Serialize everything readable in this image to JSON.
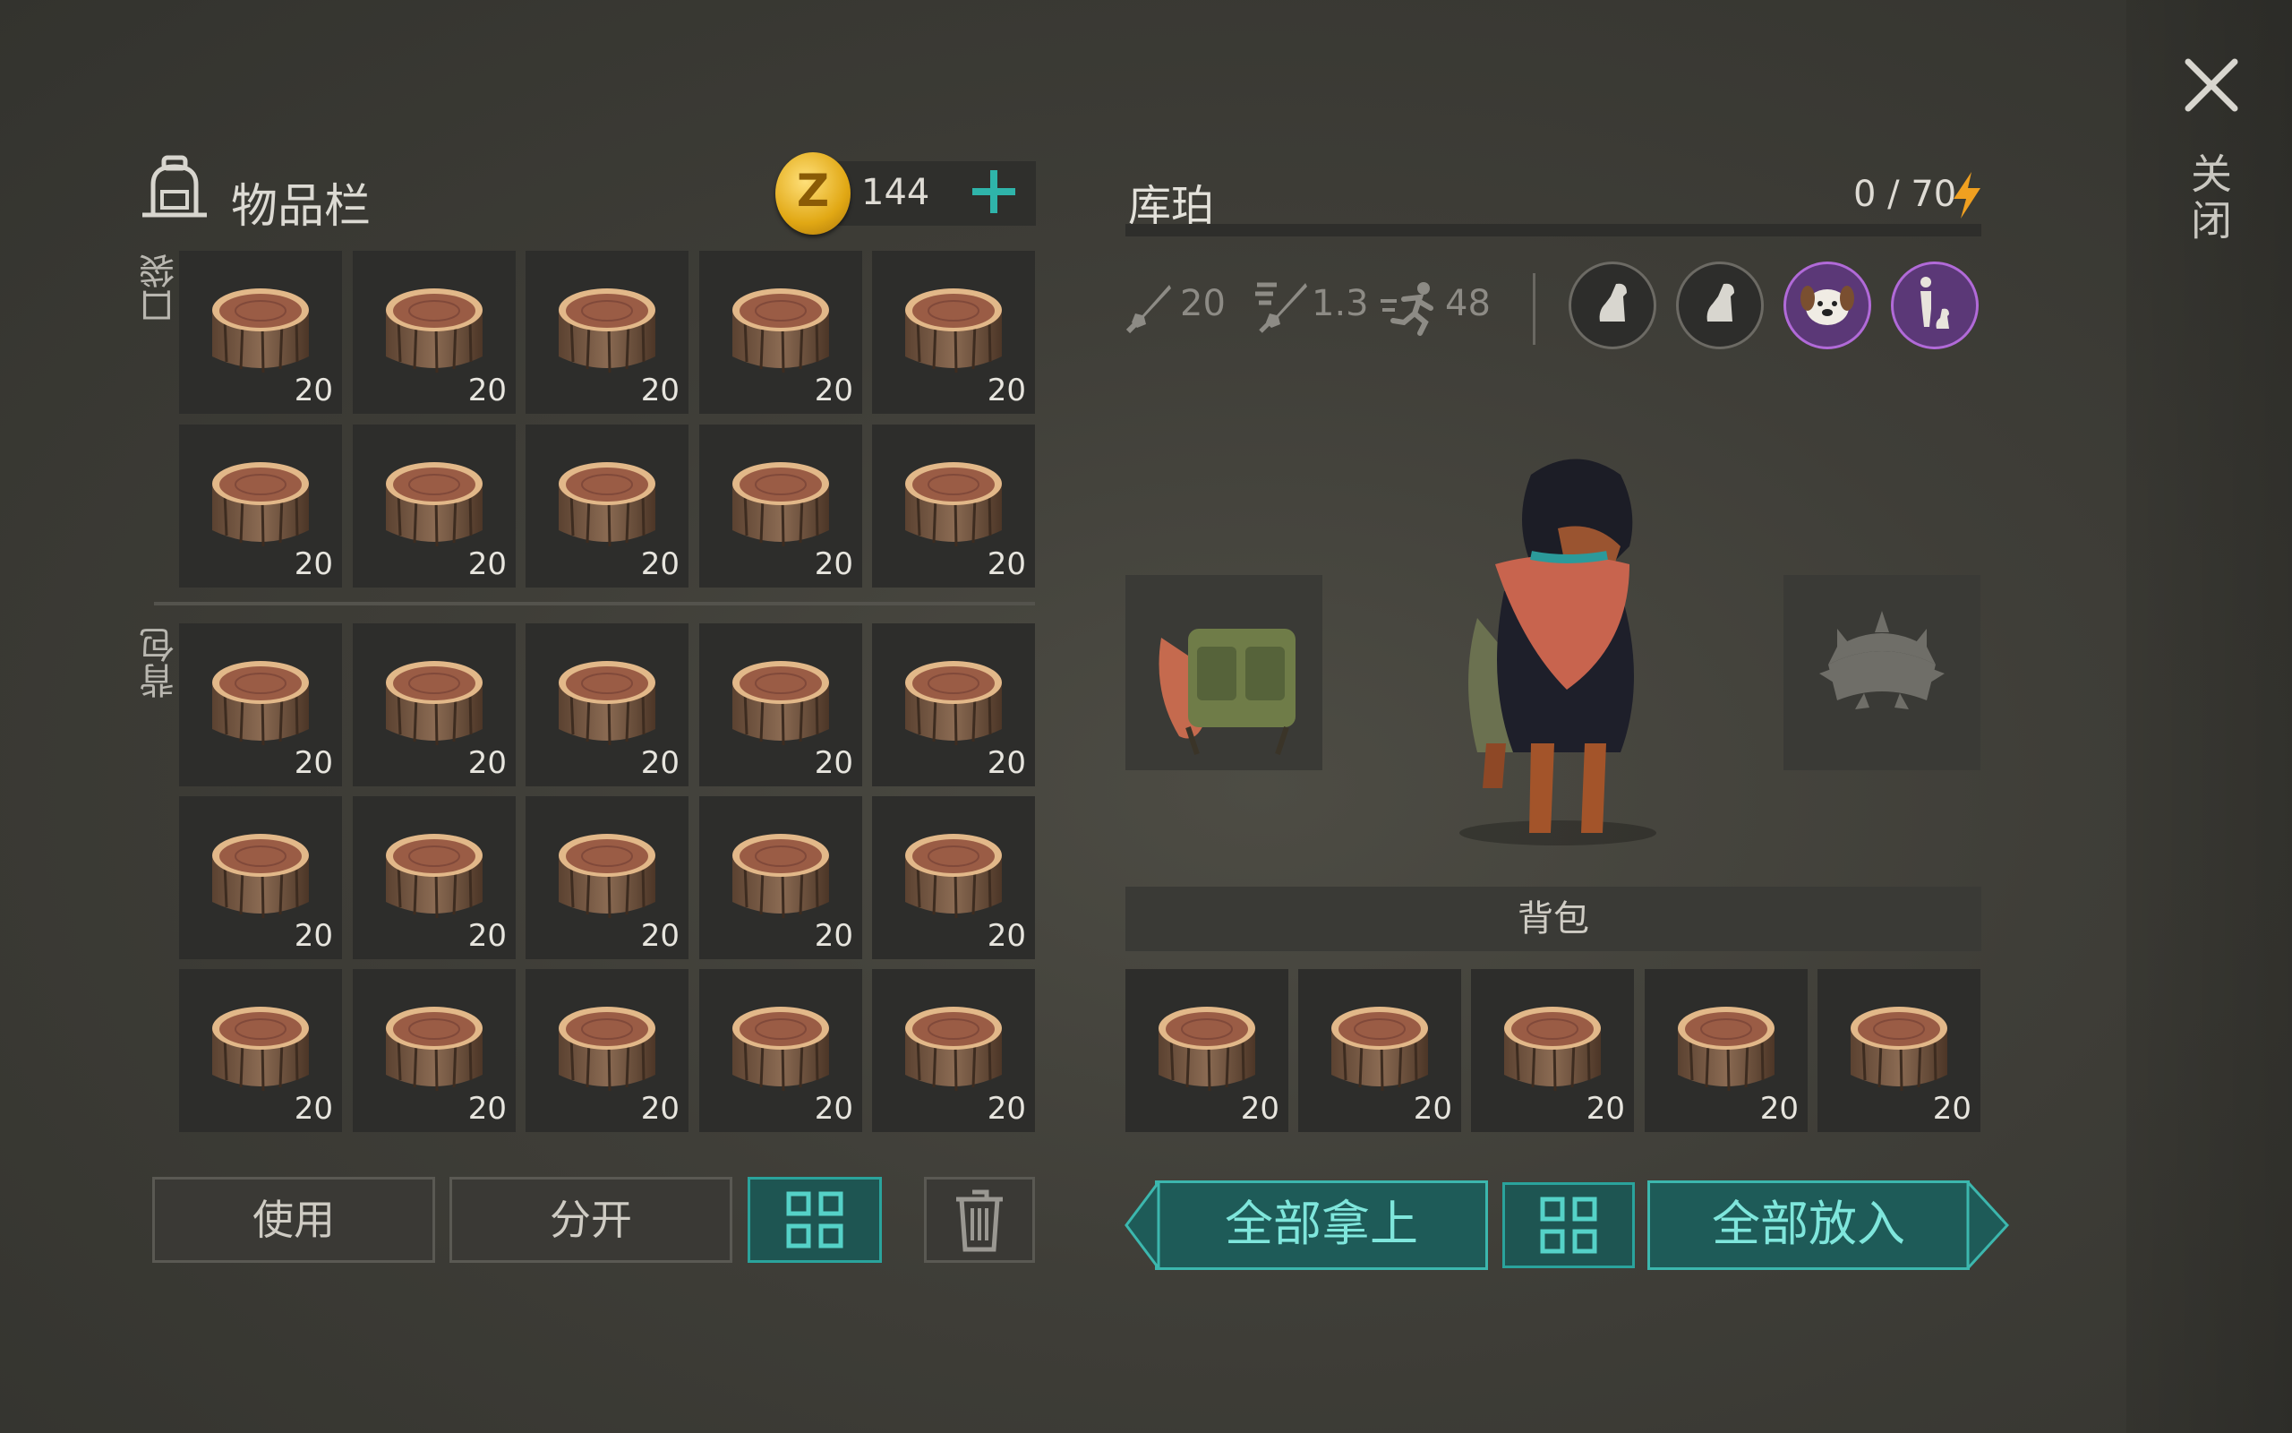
{
  "inventory": {
    "title": "物品栏",
    "coins": "144",
    "pocket_label": "口袋",
    "backpack_label": "背包",
    "item_icon": "log-icon",
    "slot_counts": [
      "20",
      "20",
      "20",
      "20",
      "20",
      "20",
      "20",
      "20",
      "20",
      "20",
      "20",
      "20",
      "20",
      "20",
      "20",
      "20",
      "20",
      "20",
      "20",
      "20",
      "20",
      "20",
      "20",
      "20",
      "20"
    ]
  },
  "actions": {
    "use": "使用",
    "split": "分开",
    "sort_icon": "grid-sort-icon",
    "delete_icon": "trash-icon"
  },
  "pet": {
    "name": "库珀",
    "capacity": "0 / 70",
    "stats": {
      "damage": "20",
      "attack_speed": "1.3",
      "speed": "48"
    },
    "abilities": [
      "sit-dog-icon",
      "sit-dog-icon",
      "dog-face-icon",
      "owner-with-dog-icon"
    ],
    "equip_left": "dog-backpack-icon",
    "equip_right": "spiked-collar-icon",
    "backpack_label": "背包",
    "slot_counts": [
      "20",
      "20",
      "20",
      "20",
      "20"
    ]
  },
  "transfer": {
    "take_all": "全部拿上",
    "put_all": "全部放入"
  },
  "close_label": "关闭",
  "colors": {
    "accent_teal": "#2aa39c",
    "ability_purple": "#b16ad8",
    "coin_gold": "#e1a814"
  }
}
